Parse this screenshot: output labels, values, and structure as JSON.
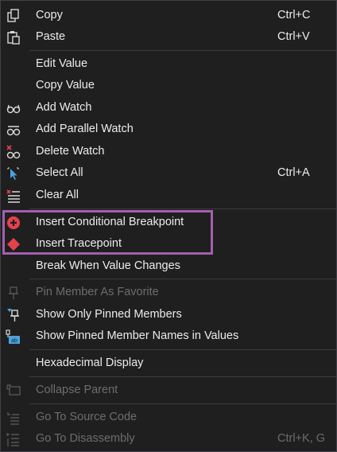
{
  "menu": {
    "items": [
      {
        "label": "Copy",
        "shortcut": "Ctrl+C",
        "icon": "copy-icon"
      },
      {
        "label": "Paste",
        "shortcut": "Ctrl+V",
        "icon": "paste-icon"
      },
      {
        "label": "Edit Value",
        "shortcut": ""
      },
      {
        "label": "Copy Value",
        "shortcut": ""
      },
      {
        "label": "Add Watch",
        "shortcut": "",
        "icon": "glasses-icon"
      },
      {
        "label": "Add Parallel Watch",
        "shortcut": "",
        "icon": "parallel-watch-icon"
      },
      {
        "label": "Delete Watch",
        "shortcut": "",
        "icon": "delete-watch-icon"
      },
      {
        "label": "Select All",
        "shortcut": "Ctrl+A",
        "icon": "select-all-icon"
      },
      {
        "label": "Clear All",
        "shortcut": "",
        "icon": "clear-all-icon"
      },
      {
        "label": "Insert Conditional Breakpoint",
        "shortcut": "",
        "icon": "conditional-breakpoint-icon"
      },
      {
        "label": "Insert Tracepoint",
        "shortcut": "",
        "icon": "tracepoint-icon"
      },
      {
        "label": "Break When Value Changes",
        "shortcut": ""
      },
      {
        "label": "Pin Member As Favorite",
        "shortcut": "",
        "icon": "pin-icon",
        "disabled": true
      },
      {
        "label": "Show Only Pinned Members",
        "shortcut": "",
        "icon": "filter-pin-icon"
      },
      {
        "label": "Show Pinned Member Names in Values",
        "shortcut": "",
        "icon": "member-names-icon"
      },
      {
        "label": "Hexadecimal Display",
        "shortcut": ""
      },
      {
        "label": "Collapse Parent",
        "shortcut": "",
        "icon": "collapse-parent-icon",
        "disabled": true
      },
      {
        "label": "Go To Source Code",
        "shortcut": "",
        "icon": "source-code-icon",
        "disabled": true
      },
      {
        "label": "Go To Disassembly",
        "shortcut": "Ctrl+K, G",
        "icon": "disassembly-icon",
        "disabled": true
      }
    ]
  },
  "colors": {
    "background": "#1f1f20",
    "text": "#ececec",
    "disabled_text": "#6d6d6d",
    "highlight_border": "#a45fae",
    "breakpoint_red": "#e5414b"
  }
}
